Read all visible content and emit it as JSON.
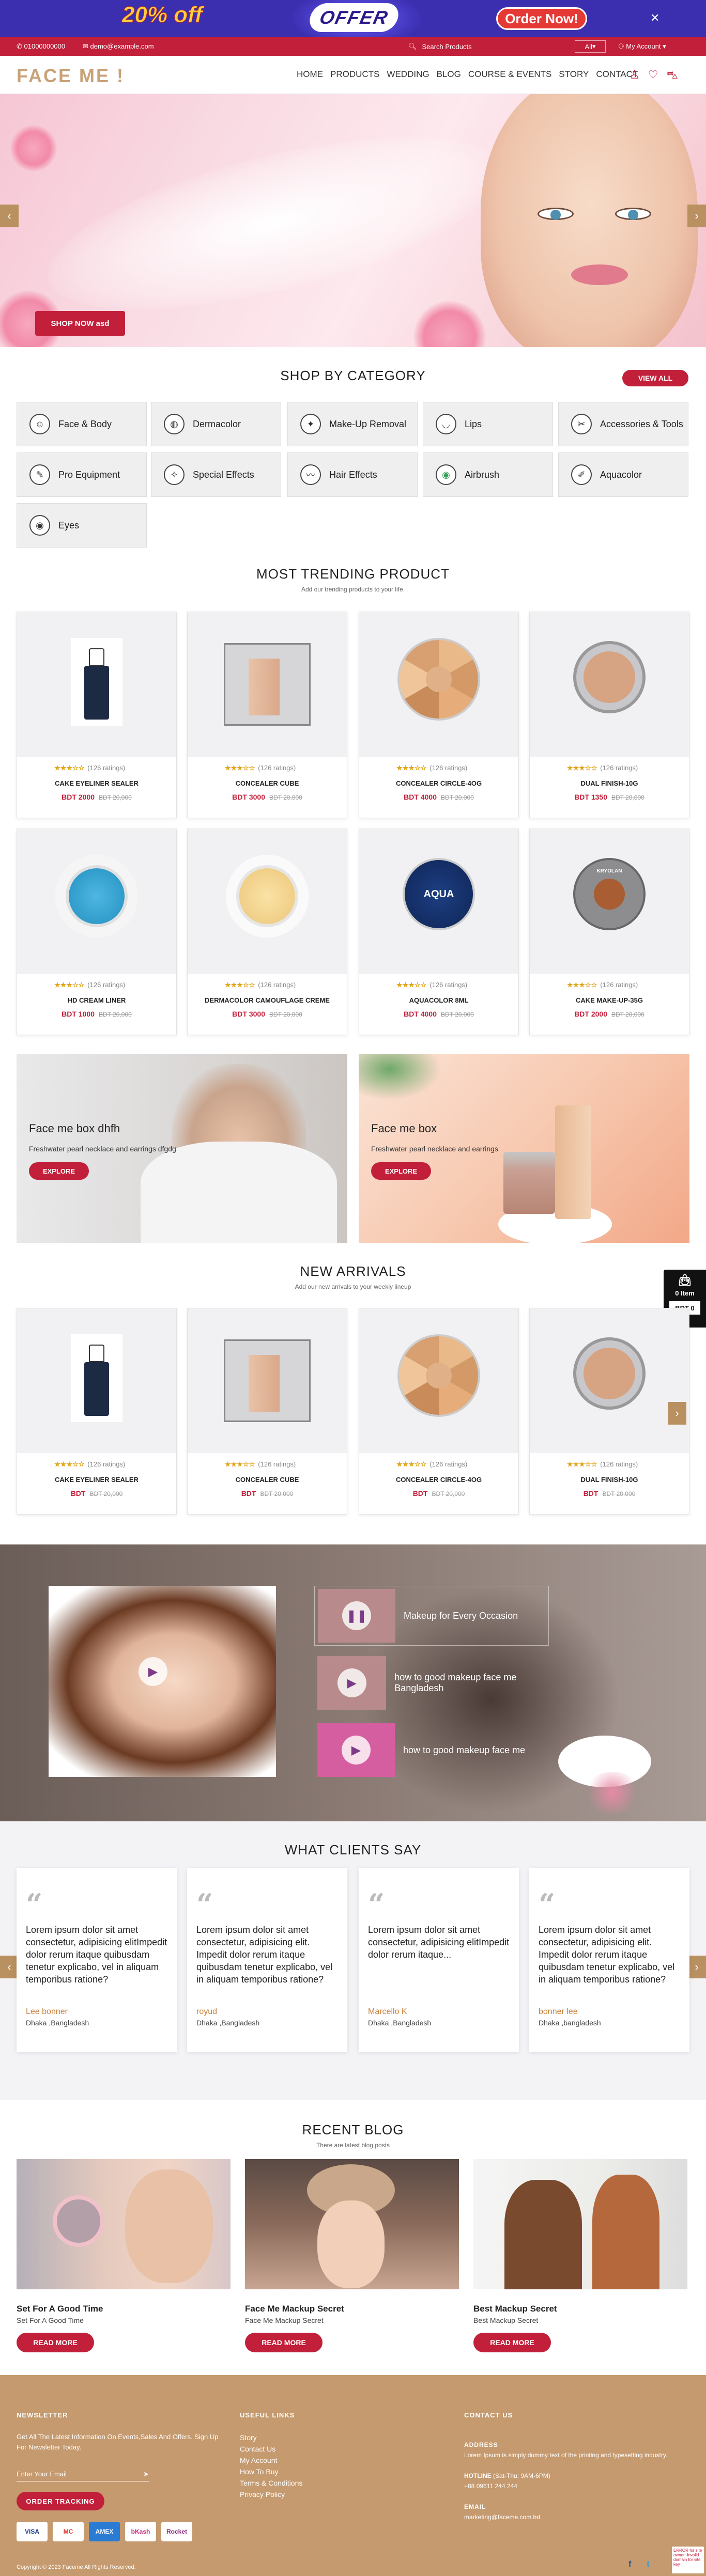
{
  "promo": {
    "percent": "20% off",
    "offer": "OFFER",
    "order": "Order Now!",
    "close": "✕"
  },
  "topbar": {
    "phone": "01000000000",
    "email": "demo@example.com",
    "search_placeholder": "Search Products",
    "all": "All",
    "my_account": "My Account"
  },
  "header": {
    "logo": "FACE ME !",
    "nav": [
      "HOME",
      "PRODUCTS",
      "WEDDING",
      "BLOG",
      "COURSE & EVENTS",
      "STORY",
      "CONTACT"
    ]
  },
  "hero": {
    "button": "SHOP NOW asd"
  },
  "categories": {
    "title": "SHOP BY CATEGORY",
    "view_all": "VIEW ALL",
    "items": [
      {
        "label": "Face & Body",
        "icon": "face-icon",
        "glyph": "☺"
      },
      {
        "label": "Dermacolor",
        "icon": "globe-icon",
        "glyph": "◍"
      },
      {
        "label": "Make-Up Removal",
        "icon": "removal-icon",
        "glyph": "✦"
      },
      {
        "label": "Lips",
        "icon": "lips-icon",
        "glyph": "◡"
      },
      {
        "label": "Accessories & Tools",
        "icon": "accessories-icon",
        "glyph": "✂"
      },
      {
        "label": "Pro Equipment",
        "icon": "pen-icon",
        "glyph": "✎"
      },
      {
        "label": "Special Effects",
        "icon": "brush-icon",
        "glyph": "✧"
      },
      {
        "label": "Hair Effects",
        "icon": "hair-icon",
        "glyph": "〰"
      },
      {
        "label": "Airbrush",
        "icon": "airbrush-icon",
        "glyph": "◉"
      },
      {
        "label": "Aquacolor",
        "icon": "aquacolor-icon",
        "glyph": "✐"
      },
      {
        "label": "Eyes",
        "icon": "eye-icon",
        "glyph": "◉"
      }
    ]
  },
  "trending": {
    "title": "MOST TRENDING PRODUCT",
    "subtitle": "Add our trending products to your life.",
    "products": [
      {
        "name": "CAKE EYELINER SEALER",
        "price": "BDT 2000",
        "old": "BDT 20,000",
        "stars": "★★★☆☆",
        "ratings": "(126 ratings)",
        "img": "bottle"
      },
      {
        "name": "CONCEALER CUBE",
        "price": "BDT 3000",
        "old": "BDT 20,000",
        "stars": "★★★☆☆",
        "ratings": "(126 ratings)",
        "img": "cube"
      },
      {
        "name": "CONCEALER CIRCLE-4OG",
        "price": "BDT 4000",
        "old": "BDT 20,000",
        "stars": "★★★☆☆",
        "ratings": "(126 ratings)",
        "img": "palette"
      },
      {
        "name": "DUAL FINISH-10G",
        "price": "BDT 1350",
        "old": "BDT 20,000",
        "stars": "★★★☆☆",
        "ratings": "(126 ratings)",
        "img": "compact"
      },
      {
        "name": "HD CREAM LINER",
        "price": "BDT 1000",
        "old": "BDT 20,000",
        "stars": "★★★☆☆",
        "ratings": "(126 ratings)",
        "img": "blue"
      },
      {
        "name": "DERMACOLOR CAMOUFLAGE CREME",
        "price": "BDT 3000",
        "old": "BDT 20,000",
        "stars": "★★★☆☆",
        "ratings": "(126 ratings)",
        "img": "cream"
      },
      {
        "name": "AQUACOLOR 8ML",
        "price": "BDT 4000",
        "old": "BDT 20,000",
        "stars": "★★★☆☆",
        "ratings": "(126 ratings)",
        "img": "aqua"
      },
      {
        "name": "CAKE MAKE-UP-35G",
        "price": "BDT 2000",
        "old": "BDT 20,000",
        "stars": "★★★☆☆",
        "ratings": "(126 ratings)",
        "img": "cake"
      }
    ]
  },
  "aqua_label": "AQUA",
  "cake_label": "KRYOLAN",
  "banners": [
    {
      "title": "Face me box dhfh",
      "text": "Freshwater pearl necklace and earrings dfgdg",
      "button": "EXPLORE"
    },
    {
      "title": "Face me box",
      "text": "Freshwater pearl necklace and earrings",
      "button": "EXPLORE"
    }
  ],
  "cart": {
    "items": "0 Item",
    "total": "BDT 0"
  },
  "arrivals": {
    "title": "NEW ARRIVALS",
    "subtitle": "Add our new arrivals to your weekly lineup",
    "products": [
      {
        "name": "CAKE EYELINER SEALER",
        "price": "BDT",
        "old": "BDT 20,000",
        "stars": "★★★☆☆",
        "ratings": "(126 ratings)",
        "img": "bottle"
      },
      {
        "name": "CONCEALER CUBE",
        "price": "BDT",
        "old": "BDT 20,000",
        "stars": "★★★☆☆",
        "ratings": "(126 ratings)",
        "img": "cube"
      },
      {
        "name": "CONCEALER CIRCLE-4OG",
        "price": "BDT",
        "old": "BDT 20,000",
        "stars": "★★★☆☆",
        "ratings": "(126 ratings)",
        "img": "palette"
      },
      {
        "name": "DUAL FINISH-10G",
        "price": "BDT",
        "old": "BDT 20,000",
        "stars": "★★★☆☆",
        "ratings": "(126 ratings)",
        "img": "compact"
      }
    ]
  },
  "videos": [
    {
      "title": "Makeup for Every Occasion"
    },
    {
      "title": "how to good makeup face me Bangladesh"
    },
    {
      "title": "how to good makeup face me"
    }
  ],
  "testimonials": {
    "title": "WHAT CLIENTS SAY",
    "items": [
      {
        "text": "Lorem ipsum dolor sit amet consectetur, adipisicing elitImpedit dolor rerum itaque quibusdam tenetur explicabo, vel in aliquam temporibus ratione?",
        "name": "Lee bonner",
        "loc": "Dhaka ,Bangladesh"
      },
      {
        "text": "Lorem ipsum dolor sit amet consectetur, adipisicing elit. Impedit dolor rerum itaque quibusdam tenetur explicabo, vel in aliquam temporibus ratione?",
        "name": "royud",
        "loc": "Dhaka ,Bangladesh"
      },
      {
        "text": "Lorem ipsum dolor sit amet consectetur, adipisicing elitImpedit dolor rerum itaque...",
        "name": "Marcello K",
        "loc": "Dhaka ,Bangladesh"
      },
      {
        "text": "Lorem ipsum dolor sit amet consectetur, adipisicing elit. Impedit dolor rerum itaque quibusdam tenetur explicabo, vel in aliquam temporibus ratione?",
        "name": "bonner lee",
        "loc": "Dhaka ,bangladesh"
      }
    ]
  },
  "blog": {
    "title": "RECENT BLOG",
    "subtitle": "There are latest blog posts",
    "posts": [
      {
        "title": "Set For A Good Time",
        "sub": "Set For A Good Time",
        "button": "READ MORE"
      },
      {
        "title": "Face Me Mackup Secret",
        "sub": "Face Me Mackup Secret",
        "button": "READ MORE"
      },
      {
        "title": "Best Mackup Secret",
        "sub": "Best Mackup Secret",
        "button": "READ MORE"
      }
    ]
  },
  "footer": {
    "newsletter_title": "NEWSLETTER",
    "newsletter_text": "Get All The Latest Information On Events,Sales And Offers. Sign Up For Newsletter Today.",
    "email_placeholder": "Enter Your Email",
    "order_tracking": "ORDER TRACKING",
    "useful_title": "USEFUL LINKS",
    "links": [
      "Story",
      "Contact Us",
      "My Account",
      "How To Buy",
      "Terms & Conditions",
      "Privacy Policy"
    ],
    "contact_title": "CONTACT US",
    "address_label": "ADDRESS",
    "address": "Lorem Ipsum is simply dummy text of the printing and typesetting industry.",
    "hotline_label": "HOTLINE",
    "hotline_hours": "(Sat-Thu; 9AM-6PM)",
    "hotline": "+88 09611 244 244",
    "email_label": "EMAIL",
    "email": "marketing@faceme.com.bd",
    "copyright": "Copyright © 2023 Faceme All Rights Reserved.",
    "payments": [
      "VISA",
      "MC",
      "AMEX",
      "bKash",
      "Rocket"
    ]
  },
  "error_badge": "ERROR for site owner: Invalid domain for site key"
}
